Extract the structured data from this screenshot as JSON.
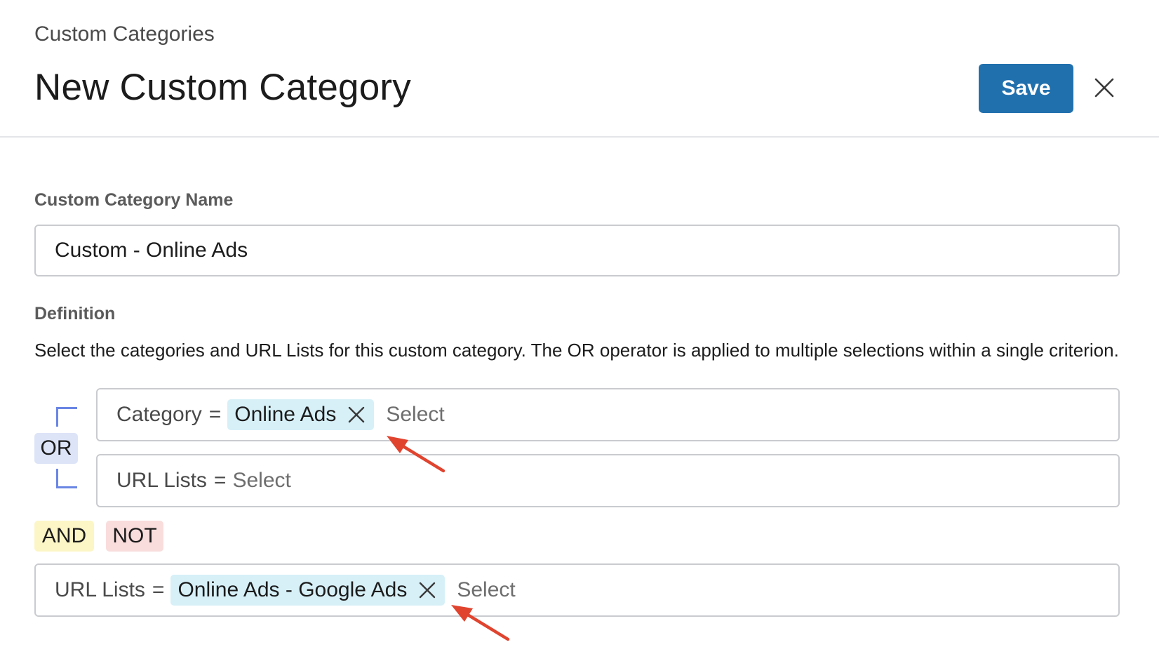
{
  "header": {
    "breadcrumb": "Custom Categories",
    "title": "New Custom Category",
    "save_label": "Save"
  },
  "name_section": {
    "label": "Custom Category Name",
    "value": "Custom - Online Ads"
  },
  "definition": {
    "label": "Definition",
    "description": "Select the categories and URL Lists for this custom category. The OR operator is applied to multiple selections within a single criterion.",
    "group_operator": "OR",
    "criteria": [
      {
        "field": "Category",
        "operator": "=",
        "chips": [
          "Online Ads"
        ],
        "placeholder": "Select"
      },
      {
        "field": "URL Lists",
        "operator": "=",
        "chips": [],
        "placeholder": "Select"
      }
    ],
    "join_operators": {
      "and": "AND",
      "not": "NOT"
    },
    "excluded": {
      "field": "URL Lists",
      "operator": "=",
      "chips": [
        "Online Ads - Google Ads"
      ],
      "placeholder": "Select"
    }
  },
  "colors": {
    "primary": "#2170ae",
    "chip_bg": "#d7f0f8",
    "or_bg": "#dde4f8",
    "and_bg": "#fcf6c6",
    "not_bg": "#f9dcdc",
    "bracket": "#6a86e4",
    "annotation_arrow": "#e0442f"
  },
  "icons": {
    "close": "close-icon",
    "chip_remove": "x-icon",
    "annotation": "red-arrow"
  }
}
